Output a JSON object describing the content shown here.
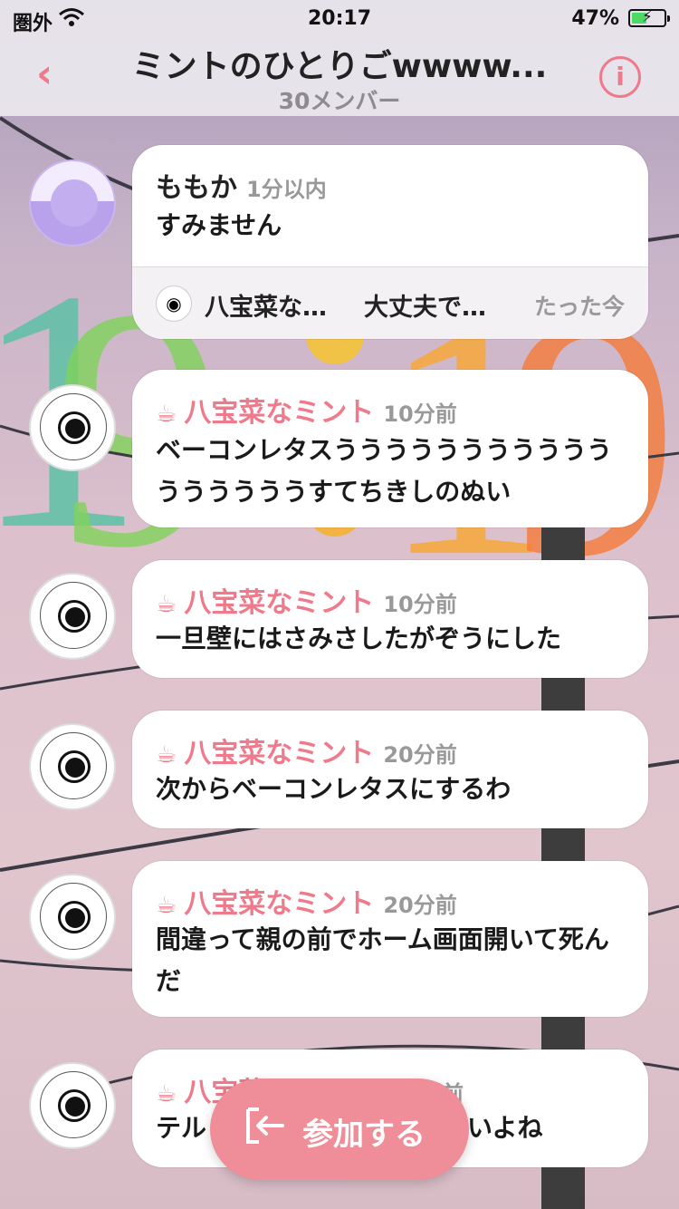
{
  "status_bar": {
    "carrier": "圏外",
    "time": "20:17",
    "battery_percent": "47%",
    "battery_level": 0.47
  },
  "header": {
    "back_icon": "chevron-left-icon",
    "title": "ミントのひとりごwwww...",
    "subtitle": "30メンバー",
    "info_icon": "info-icon"
  },
  "messages": [
    {
      "name": "ももか",
      "time": "1分以内",
      "text": "すみません",
      "reply": {
        "name": "八宝菜な…",
        "text": "大丈夫で…",
        "time": "たった今"
      }
    },
    {
      "name": "八宝菜なミント",
      "time": "10分前",
      "text": "ベーコンレタスうううううううううううううううううすてちきしのぬい"
    },
    {
      "name": "八宝菜なミント",
      "time": "10分前",
      "text": "一旦壁にはさみさしたがぞうにした"
    },
    {
      "name": "八宝菜なミント",
      "time": "20分前",
      "text": "次からベーコンレタスにするわ"
    },
    {
      "name": "八宝菜なミント",
      "time": "20分前",
      "text": "間違って親の前でホーム画面開いて死んだ"
    },
    {
      "name": "八宝菜なミント",
      "time": "1時間前",
      "text": "テル",
      "text_tail": "いよね"
    }
  ],
  "join_button": {
    "label": "参加する",
    "icon": "enter-icon"
  },
  "colors": {
    "accent": "#ee7a8c",
    "join_bg": "#ef8d98"
  }
}
